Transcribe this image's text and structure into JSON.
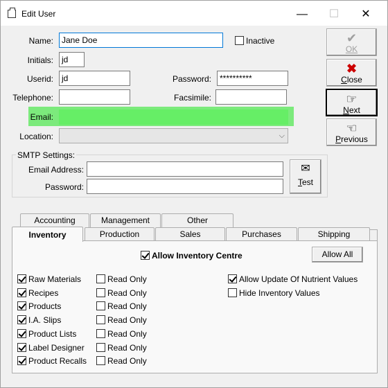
{
  "window": {
    "title": "Edit User"
  },
  "titlebar": {
    "minimize": "—",
    "maximize": "☐",
    "close": "✕"
  },
  "form": {
    "name_label": "Name:",
    "name_value": "Jane Doe",
    "inactive_label": "Inactive",
    "inactive_checked": false,
    "initials_label": "Initials:",
    "initials_value": "jd",
    "userid_label": "Userid:",
    "userid_value": "jd",
    "password_label": "Password:",
    "password_value": "**********",
    "telephone_label": "Telephone:",
    "telephone_value": "",
    "facsimile_label": "Facsimile:",
    "facsimile_value": "",
    "email_label": "Email:",
    "email_value": "",
    "location_label": "Location:",
    "location_value": ""
  },
  "smtp": {
    "group_label": "SMTP Settings:",
    "email_label": "Email Address:",
    "email_value": "",
    "password_label": "Password:",
    "password_value": "",
    "test_button": "Test"
  },
  "buttons": {
    "ok": "OK",
    "close": "Close",
    "next": "Next",
    "previous": "Previous"
  },
  "tabs": {
    "row_back": [
      "Accounting",
      "Management",
      "Other"
    ],
    "row_front": [
      "Inventory",
      "Production",
      "Sales",
      "Purchases",
      "Shipping"
    ],
    "active": "Inventory"
  },
  "inventory": {
    "allow_centre_label": "Allow Inventory Centre",
    "allow_all_button": "Allow All",
    "items": [
      {
        "label": "Raw Materials",
        "checked": true,
        "readonly_label": "Read Only",
        "readonly": false
      },
      {
        "label": "Recipes",
        "checked": true,
        "readonly_label": "Read Only",
        "readonly": false
      },
      {
        "label": "Products",
        "checked": true,
        "readonly_label": "Read Only",
        "readonly": false
      },
      {
        "label": "I.A. Slips",
        "checked": true,
        "readonly_label": "Read Only",
        "readonly": false
      },
      {
        "label": "Product Lists",
        "checked": true,
        "readonly_label": "Read Only",
        "readonly": false
      },
      {
        "label": "Label Designer",
        "checked": true,
        "readonly_label": "Read Only",
        "readonly": false
      },
      {
        "label": "Product Recalls",
        "checked": true,
        "readonly_label": "Read Only",
        "readonly": false
      }
    ],
    "allow_update_nutrient_label": "Allow Update Of Nutrient Values",
    "allow_update_nutrient_checked": true,
    "hide_inventory_values_label": "Hide Inventory Values",
    "hide_inventory_values_checked": false
  },
  "colors": {
    "email_highlight": "#7cea7c",
    "focus_border": "#0078d7"
  }
}
